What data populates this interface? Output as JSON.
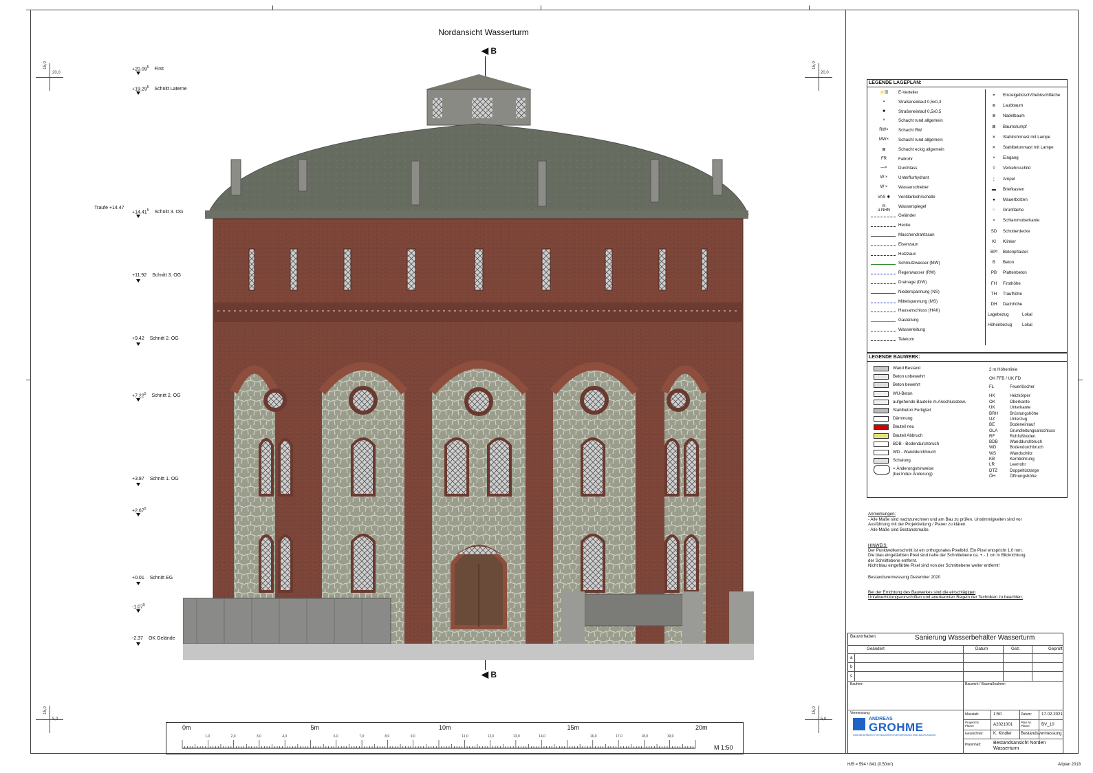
{
  "drawing": {
    "title": "Nordansicht Wasserturm",
    "section_label": "B"
  },
  "levels": [
    {
      "value": "+20.09",
      "sup": "5",
      "label": "First"
    },
    {
      "value": "+19.29",
      "sup": "5",
      "label": "Schnitt Laterne"
    },
    {
      "value": "+14.41",
      "sup": "5",
      "label": "Schnitt 3. OG",
      "prefix": "Traufe +14.47"
    },
    {
      "value": "+11.92",
      "sup": "",
      "label": "Schnitt 3. OG"
    },
    {
      "value": "+9.42",
      "sup": "",
      "label": "Schnitt 2. OG"
    },
    {
      "value": "+7.22",
      "sup": "5",
      "label": "Schnitt 2. OG"
    },
    {
      "value": "+3.87",
      "sup": "",
      "label": "Schnitt 1. OG"
    },
    {
      "value": "+2.67",
      "sup": "5",
      "label": ""
    },
    {
      "value": "+0.01",
      "sup": "",
      "label": "Schnitt EG"
    },
    {
      "value": "-1.07",
      "sup": "5",
      "label": ""
    },
    {
      "value": "-2.37",
      "sup": "",
      "label": "OK Gelände"
    }
  ],
  "crosshairs": {
    "top_value": "20,0",
    "top_alt": "15,0",
    "bottom_value": "5,0",
    "bottom_alt": "15,0"
  },
  "legend_lageplan": {
    "title": "LEGENDE LAGEPLAN:",
    "left_items": [
      {
        "sym": "⚡☒",
        "label": "E-Verteiler"
      },
      {
        "sym": "▪",
        "label": "Straßeneinlauf 0,5x0,3"
      },
      {
        "sym": "■",
        "label": "Straßeneinlauf 0,5x0,5"
      },
      {
        "sym": "×",
        "label": "Schacht rund allgemein"
      },
      {
        "sym": "RW×",
        "label": "Schacht RW"
      },
      {
        "sym": "MW×",
        "label": "Schacht rund allgemein"
      },
      {
        "sym": "⊠",
        "label": "Schacht eckig allgemein"
      },
      {
        "sym": "FR",
        "label": "Fallrohr"
      },
      {
        "sym": "—×",
        "label": "Durchlass"
      },
      {
        "sym": "W ×",
        "label": "Unterflurhydrant"
      },
      {
        "sym": "W ×",
        "label": "Wasserschieber"
      },
      {
        "sym": "VAS ✱",
        "label": "Ventilanbohrschelle"
      },
      {
        "sym": "m ü.NHN",
        "label": "Wasserspiegel"
      },
      {
        "sym": "",
        "label": "Geländer"
      },
      {
        "sym": "",
        "label": "Hecke"
      },
      {
        "sym": "",
        "label": "Maschendrahtzaun"
      },
      {
        "sym": "",
        "label": "Eisenzaun"
      },
      {
        "sym": "",
        "label": "Holzzaun"
      },
      {
        "sym": "",
        "label": "Schmutzwasser (MW)"
      },
      {
        "sym": "",
        "label": "Regenwasser (RW)"
      },
      {
        "sym": "",
        "label": "Drainage (DW)"
      },
      {
        "sym": "",
        "label": "Niederspannung (NS)"
      },
      {
        "sym": "",
        "label": "Mittelspannung (MS)"
      },
      {
        "sym": "",
        "label": "Hausanschluss (HAK)"
      },
      {
        "sym": "",
        "label": "Gasleitung"
      },
      {
        "sym": "",
        "label": "Wasserleitung"
      },
      {
        "sym": "",
        "label": "Telekom"
      }
    ],
    "right_items": [
      {
        "sym": "⌖",
        "label": "Einzelgebüsch/Gebüschfläche"
      },
      {
        "sym": "⊛",
        "label": "Laubbaum"
      },
      {
        "sym": "⊗",
        "label": "Nadelbaum"
      },
      {
        "sym": "⊠",
        "label": "Baumstumpf"
      },
      {
        "sym": "✕",
        "label": "Stahlrohrmast mit Lampe"
      },
      {
        "sym": "✕",
        "label": "Stahlbetonmast mit Lampe"
      },
      {
        "sym": "×",
        "label": "Eingang"
      },
      {
        "sym": "◊",
        "label": "Verkehrsschild"
      },
      {
        "sym": "⋮",
        "label": "Ampel"
      },
      {
        "sym": "▬",
        "label": "Briefkasten"
      },
      {
        "sym": "●",
        "label": "Mauerbolzen"
      },
      {
        "sym": "⁘",
        "label": "Grünfläche"
      },
      {
        "sym": "×",
        "label": "Schlammoberkante"
      },
      {
        "sym": "SD",
        "label": "Schotterdecke"
      },
      {
        "sym": "KI",
        "label": "Klinker"
      },
      {
        "sym": "BPf",
        "label": "Betonpflaster"
      },
      {
        "sym": "B",
        "label": "Beton"
      },
      {
        "sym": "PB",
        "label": "Plattenbeton"
      },
      {
        "sym": "FH",
        "label": "Firsthöhe"
      },
      {
        "sym": "TH",
        "label": "Traufhöhe"
      },
      {
        "sym": "DH",
        "label": "Dachhöhe"
      },
      {
        "sym": "Lagebezug",
        "label": "Lokal"
      },
      {
        "sym": "Höhenbezug",
        "label": "Lokal"
      }
    ]
  },
  "legend_bauwerk": {
    "title": "LEGENDE BAUWERK:",
    "left_items": [
      {
        "label": "Wand Bestand",
        "fill": "#c8c8c8"
      },
      {
        "label": "Beton unbewehrt",
        "fill": "#e8e8e8"
      },
      {
        "label": "Beton bewehrt",
        "fill": "#dcdcdc"
      },
      {
        "label": "WU-Beton",
        "fill": "#eeeeee"
      },
      {
        "label": "aufgehende Bauteile m.Anschlussbew.",
        "fill": "#f0f0f0"
      },
      {
        "label": "Stahlbeton Fertigteil",
        "fill": "#bbbbbb"
      },
      {
        "label": "Dämmung",
        "fill": "#ffffff"
      },
      {
        "label": "Bauteil neu",
        "fill": "#d00000"
      },
      {
        "label": "Bauteil Abbruch",
        "fill": "#e8e070"
      },
      {
        "label": "BDB - Bodendurchbruch",
        "fill": "#ffffff"
      },
      {
        "label": "WD - Wanddurchbruch",
        "fill": "#ffffff"
      },
      {
        "label": "Schalung",
        "fill": "#e0e0e0"
      },
      {
        "label": "= Änderungshinweise",
        "fill": ""
      },
      {
        "label": "(bei Index Änderung)",
        "fill": ""
      }
    ],
    "right_items": [
      {
        "sym": "2 m Höhenlinie",
        "label": ""
      },
      {
        "sym": "OK FFB / UK FD",
        "label": ""
      },
      {
        "sym": "FL",
        "label": "Feuerlöscher"
      },
      {
        "sym": "HK",
        "label": "Heizkörper"
      },
      {
        "sym": "OK",
        "label": "Oberkante"
      },
      {
        "sym": "UK",
        "label": "Unterkante"
      },
      {
        "sym": "BRH",
        "label": "Brüstungshöhe"
      },
      {
        "sym": "UZ",
        "label": "Unterzug"
      },
      {
        "sym": "BE",
        "label": "Bodeneinlauf"
      },
      {
        "sym": "GLA",
        "label": "Grundleitungsanschluss"
      },
      {
        "sym": "RF",
        "label": "Rohfußboden"
      },
      {
        "sym": "BDB",
        "label": "Wanddurchbruch"
      },
      {
        "sym": "WD",
        "label": "Bodendurchbruch"
      },
      {
        "sym": "WS",
        "label": "Wandschlitz"
      },
      {
        "sym": "KB",
        "label": "Kernbohrung"
      },
      {
        "sym": "LR",
        "label": "Leerrohr"
      },
      {
        "sym": "DTZ",
        "label": "Doppeltürzarge"
      },
      {
        "sym": "ÖH",
        "label": "Öffnungshöhe"
      }
    ]
  },
  "notes": {
    "anmerkungen_title": "Anmerkungen:",
    "anmerkungen": [
      "- Alle Maße sind nachzurechnen und am Bau zu prüfen. Unstimmigkeiten sind vor",
      "  Ausführung mit der Projektleitung / Planer zu klären.",
      "- Alle Maße sind Bestandsmaße."
    ],
    "hinweis_title": "HINWEIS:",
    "hinweis": [
      "Der Punktwolkenschnitt ist ein orthogonales Pixelbild. Ein Pixel entspricht 1,0 mm.",
      "Die blau eingefärbten Pixel sind nahe der Schnittebene ca. + - 1 cm in Blickrichtung",
      "der Schnittebene entfernt.",
      "Nicht blau eingefärbte Pixel sind von der Schnittebene weiter entfernt!"
    ],
    "bestand": "Bestandsvermessung Dezember 2020",
    "unfall": [
      "Bei der Errichtung des Bauwerkes sind die einschlägigen",
      "Unfallverhütungsvorschriften und anerkannten Regeln der Techniken zu beachten."
    ]
  },
  "title_block": {
    "bauvorhaben_label": "Bauvorhaben:",
    "bauvorhaben": "Sanierung Wasserbehälter Wasserturm",
    "col_geaendert": "Geändert",
    "col_datum": "Datum",
    "col_gez": "Gez.",
    "col_geprueft": "Geprüft",
    "rows": [
      "a",
      "b",
      "c"
    ],
    "bauherr": "Bauherr:",
    "bauwerk": "Bauwerk / Baumaßnahme:",
    "vermessung": "Vermessung:",
    "massstab_label": "Masstab:",
    "massstab": "1:50",
    "datum_label": "Datum:",
    "datum": "17.02.2021",
    "projekt_label": "Projekt Nr. Planer",
    "projekt": "A2021001",
    "plan_label": "Plan Nr. Planer",
    "plan": "BV_10",
    "gezeichnet_label": "Gezeichnet:",
    "gezeichnet": "K. Kindler",
    "art": "Bestandsvermessung",
    "planinhalt_label": "Planinhalt:",
    "planinhalt_1": "Bestandsansicht Norden",
    "planinhalt_2": "Wasserturm",
    "company_small": "ANDREAS",
    "company": "GROHME",
    "company_sub": "INGENIEURBÜRO FÜR BAUWERKSVERMESSUNG UND BAUPLANUNG"
  },
  "scale": {
    "major": [
      "0m",
      "5m",
      "10m",
      "15m",
      "20m"
    ],
    "minor": [
      "1,0",
      "2,0",
      "3,0",
      "4,0",
      "6,0",
      "7,0",
      "8,0",
      "9,0",
      "11,0",
      "12,0",
      "13,0",
      "14,0",
      "16,0",
      "17,0",
      "18,0",
      "19,0"
    ],
    "ratio": "M 1:50"
  },
  "footer": {
    "left": "H/B = 594 / 841 (0.50m²)",
    "right": "Allplan 2018"
  }
}
